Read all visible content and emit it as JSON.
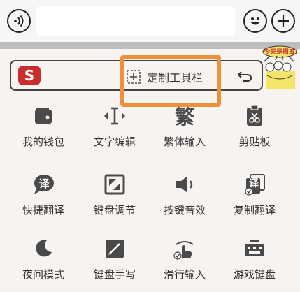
{
  "topbar": {
    "voice_icon": "voice-icon",
    "emoji_icon": "smile-icon",
    "add_icon": "plus-icon"
  },
  "toolbar": {
    "logo_letter": "S",
    "custom_label": "定制工具栏",
    "sticker_text": "今天是周五!"
  },
  "tools": [
    {
      "label": "我的钱包",
      "icon": "wallet-icon"
    },
    {
      "label": "文字编辑",
      "icon": "text-edit-icon"
    },
    {
      "label": "繁体输入",
      "icon": "traditional-icon",
      "glyph": "繁"
    },
    {
      "label": "剪贴板",
      "icon": "clipboard-icon"
    },
    {
      "label": "快捷翻译",
      "icon": "quick-translate-icon",
      "glyph": "译"
    },
    {
      "label": "键盘调节",
      "icon": "keyboard-adjust-icon"
    },
    {
      "label": "按键音效",
      "icon": "key-sound-icon"
    },
    {
      "label": "复制翻译",
      "icon": "copy-translate-icon",
      "glyph": "译"
    },
    {
      "label": "夜间模式",
      "icon": "moon-icon"
    },
    {
      "label": "键盘手写",
      "icon": "handwrite-icon"
    },
    {
      "label": "滑行输入",
      "icon": "swipe-icon"
    },
    {
      "label": "游戏键盘",
      "icon": "game-keyboard-icon"
    }
  ]
}
